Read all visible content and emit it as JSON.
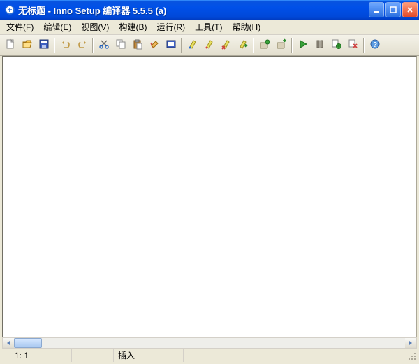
{
  "title": "无标题 - Inno Setup 编译器 5.5.5 (a)",
  "menu": {
    "file": {
      "label": "文件",
      "mn": "F"
    },
    "edit": {
      "label": "编辑",
      "mn": "E"
    },
    "view": {
      "label": "视图",
      "mn": "V"
    },
    "build": {
      "label": "构建",
      "mn": "B"
    },
    "run": {
      "label": "运行",
      "mn": "R"
    },
    "tools": {
      "label": "工具",
      "mn": "T"
    },
    "help": {
      "label": "帮助",
      "mn": "H"
    }
  },
  "toolbar": {
    "new": "new-icon",
    "open": "open-icon",
    "save": "save-icon",
    "undo": "undo-icon",
    "redo": "redo-icon",
    "cut": "cut-icon",
    "copy": "copy-icon",
    "paste": "paste-icon",
    "delete": "delete-icon",
    "find": "find-icon",
    "marker_blue": "marker-blue-icon",
    "marker_red": "marker-red-icon",
    "marker_clear": "marker-clear-icon",
    "marker_goto": "marker-goto-icon",
    "compile": "compile-icon",
    "compile_all": "compile-all-icon",
    "run": "run-icon",
    "pause": "pause-icon",
    "options": "options-icon",
    "stop": "stop-icon",
    "help": "help-icon"
  },
  "status": {
    "position": "1: 1",
    "mode": "插入"
  }
}
